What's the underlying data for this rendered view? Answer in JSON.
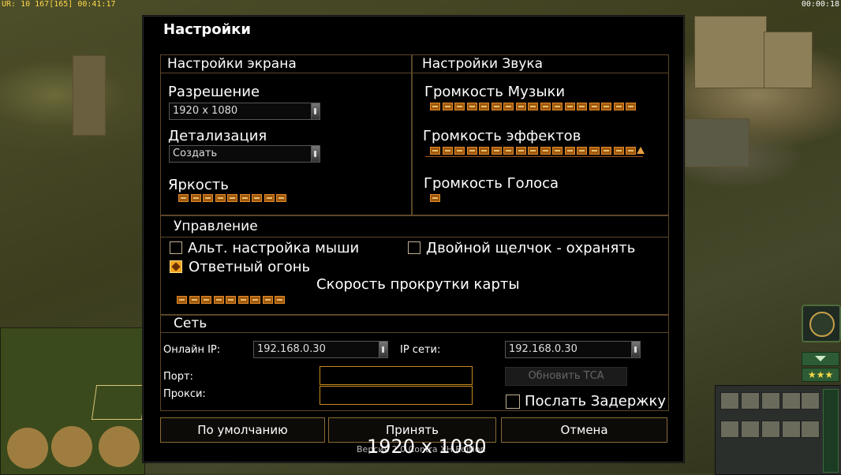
{
  "hud": {
    "top_left": "UR: 10 167[165] 00:41:17",
    "top_right": "00:00:18"
  },
  "dialog": {
    "title": "Настройки"
  },
  "screen_settings": {
    "title": "Настройки экрана",
    "resolution_label": "Разрешение",
    "resolution_value": "1920 x 1080",
    "detail_label": "Детализация",
    "detail_value": "Создать",
    "brightness_label": "Яркость",
    "brightness_level": 9
  },
  "sound_settings": {
    "title": "Настройки Звука",
    "music_label": "Громкость Музыки",
    "music_level": 17,
    "effects_label": "Громкость эффектов",
    "effects_level": 17,
    "voice_label": "Громкость Голоса",
    "voice_level": 1
  },
  "controls": {
    "title": "Управление",
    "alt_mouse_label": "Альт. настройка мыши",
    "alt_mouse_checked": false,
    "double_click_label": "Двойной щелчок - охранять",
    "double_click_checked": false,
    "return_fire_label": "Ответный огонь",
    "return_fire_checked": true,
    "scroll_speed_label": "Скорость прокрутки карты",
    "scroll_speed_level": 9
  },
  "network": {
    "title": "Сеть",
    "online_ip_label": "Онлайн IP:",
    "online_ip_value": "192.168.0.30",
    "lan_ip_label": "IP сети:",
    "lan_ip_value": "192.168.0.30",
    "port_label": "Порт:",
    "port_value": "",
    "proxy_label": "Прокси:",
    "proxy_value": "",
    "update_tca_label": "Обновить ТСА",
    "send_delay_label": "Послать Задержку",
    "send_delay_checked": false
  },
  "buttons": {
    "defaults": "По умолчанию",
    "accept": "Принять",
    "cancel": "Отмена"
  },
  "overlay": {
    "resolution_text": "1920 x 1080",
    "version_text": "Версия 2.0 Contra XH Edition"
  },
  "colors": {
    "accent": "#c78a1e",
    "slider_fill": "#a0580c",
    "section_border": "#5c4628"
  }
}
